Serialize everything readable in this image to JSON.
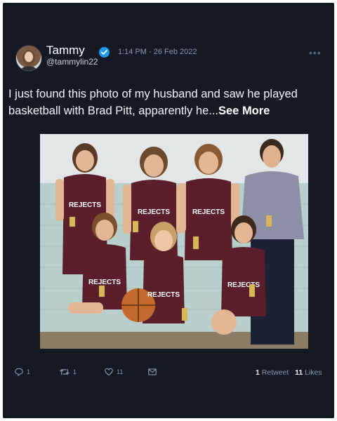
{
  "tweet": {
    "author_name": "Tammy",
    "author_handle": "@tammylin22",
    "timestamp": "1:14 PM - 26 Feb 2022",
    "text": "I just found this photo of my husband and saw he played basketball with Brad Pitt, apparently he...",
    "see_more_label": "See More",
    "image_jersey_text": "REJECTS",
    "icons": {
      "verified": "verified-badge-icon",
      "more": "more-options-icon",
      "reply": "reply-icon",
      "retweet": "retweet-icon",
      "like": "like-icon",
      "share": "share-icon"
    }
  },
  "actions": {
    "reply_count": "1",
    "retweet_count": "1",
    "like_count": "11"
  },
  "stats": {
    "retweets_value": "1",
    "retweets_label": "Retweet",
    "likes_value": "11",
    "likes_label": "Likes"
  },
  "colors": {
    "card_bg": "#141923",
    "accent": "#1d9bf0",
    "muted": "#8b98a5",
    "jersey": "#5a1f2b"
  }
}
